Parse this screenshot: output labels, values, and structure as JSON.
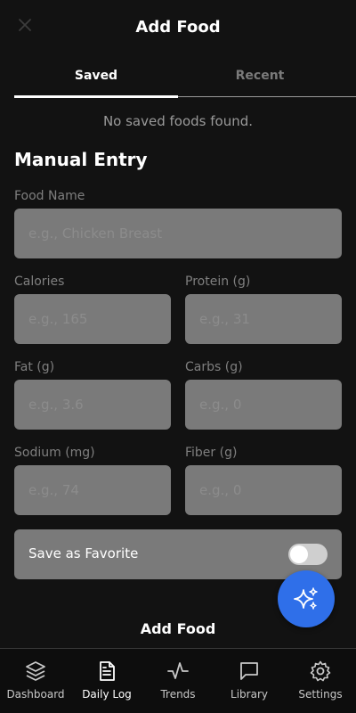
{
  "header": {
    "title": "Add Food"
  },
  "tabs": [
    {
      "label": "Saved",
      "active": true
    },
    {
      "label": "Recent",
      "active": false
    }
  ],
  "saved": {
    "empty_message": "No saved foods found."
  },
  "manual": {
    "title": "Manual Entry",
    "food_name": {
      "label": "Food Name",
      "placeholder": "e.g., Chicken Breast",
      "value": ""
    },
    "calories": {
      "label": "Calories",
      "placeholder": "e.g., 165",
      "value": ""
    },
    "protein": {
      "label": "Protein (g)",
      "placeholder": "e.g., 31",
      "value": ""
    },
    "fat": {
      "label": "Fat (g)",
      "placeholder": "e.g., 3.6",
      "value": ""
    },
    "carbs": {
      "label": "Carbs (g)",
      "placeholder": "e.g., 0",
      "value": ""
    },
    "sodium": {
      "label": "Sodium (mg)",
      "placeholder": "e.g., 74",
      "value": ""
    },
    "fiber": {
      "label": "Fiber (g)",
      "placeholder": "e.g., 0",
      "value": ""
    },
    "favorite": {
      "label": "Save as Favorite",
      "on": false
    }
  },
  "actions": {
    "add_food": "Add Food",
    "fab_icon": "sparkles-icon"
  },
  "nav": [
    {
      "label": "Dashboard",
      "icon": "layers-icon"
    },
    {
      "label": "Daily Log",
      "icon": "document-icon",
      "active": true
    },
    {
      "label": "Trends",
      "icon": "activity-icon"
    },
    {
      "label": "Library",
      "icon": "message-square-icon"
    },
    {
      "label": "Settings",
      "icon": "gear-icon"
    }
  ],
  "colors": {
    "background": "#121212",
    "input": "#7a7a7a",
    "accent": "#2f6fe9",
    "nav_background": "#0d0d0d"
  }
}
